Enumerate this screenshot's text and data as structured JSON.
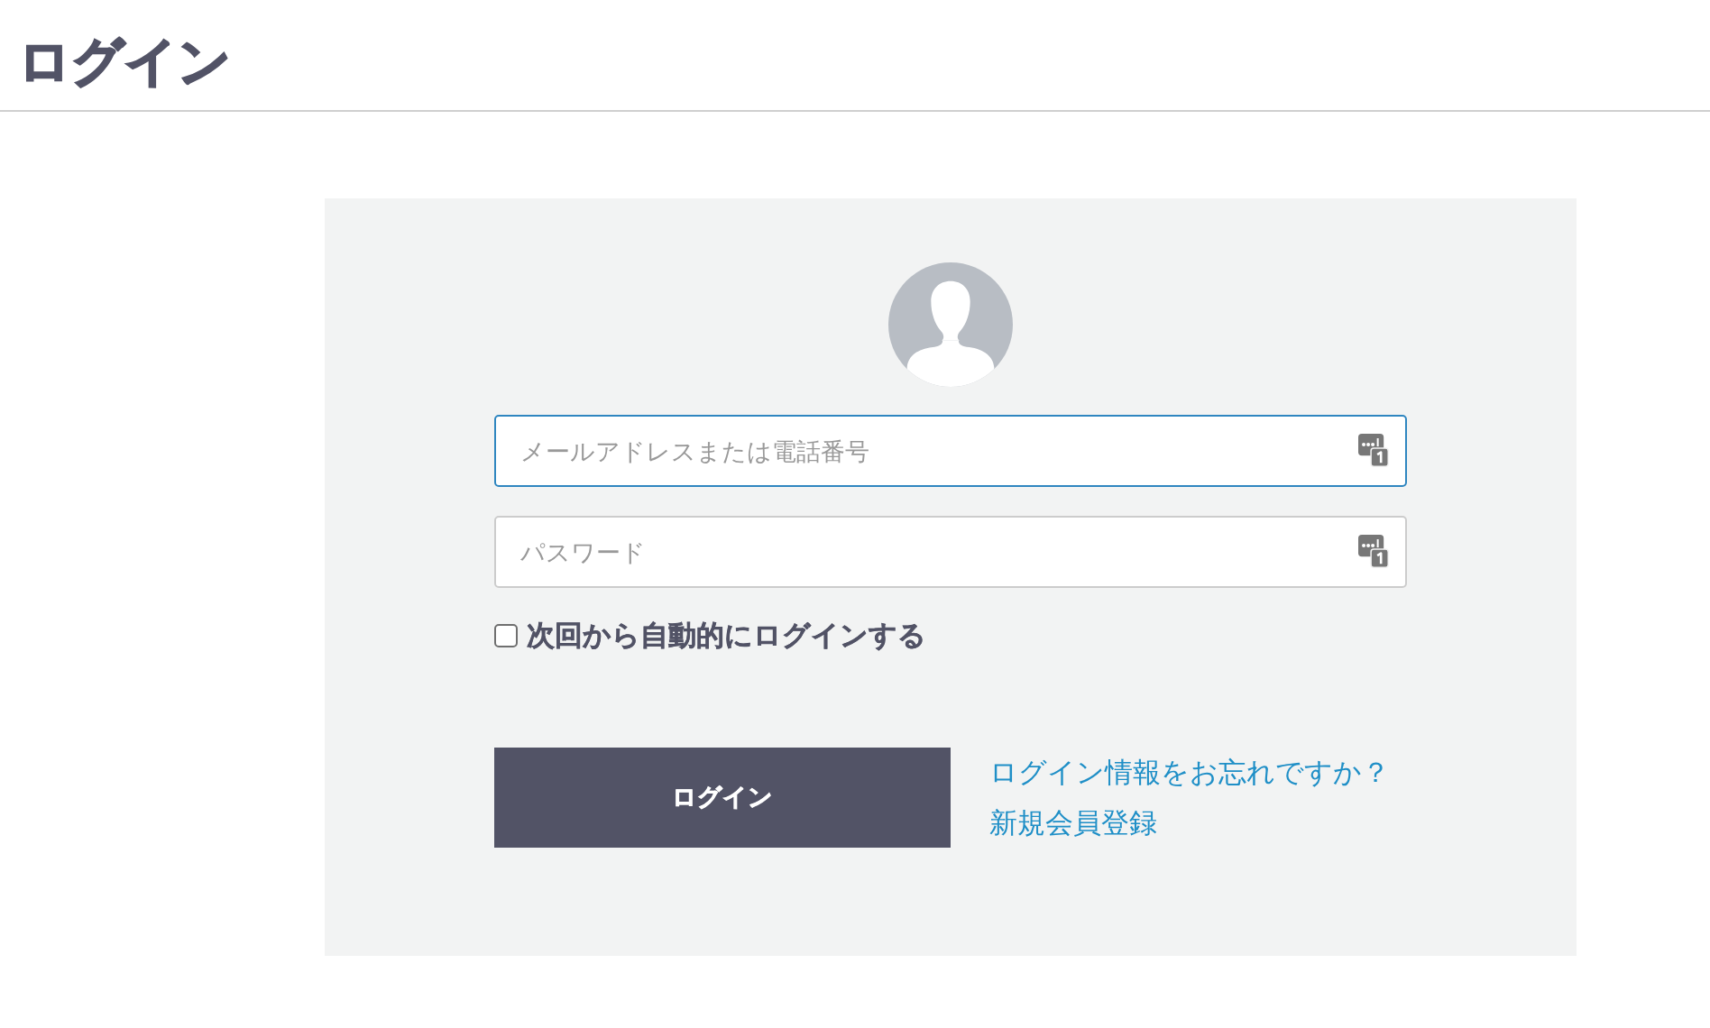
{
  "page": {
    "title": "ログイン"
  },
  "login_form": {
    "fields": [
      {
        "placeholder": "メールアドレスまたは電話番号",
        "focused": true
      },
      {
        "placeholder": "パスワード",
        "focused": false
      }
    ],
    "remember_me": {
      "label": "次回から自動的にログインする",
      "checked": false
    },
    "submit_button": "ログイン",
    "links": [
      "ログイン情報をお忘れですか？",
      "新規会員登録"
    ]
  }
}
